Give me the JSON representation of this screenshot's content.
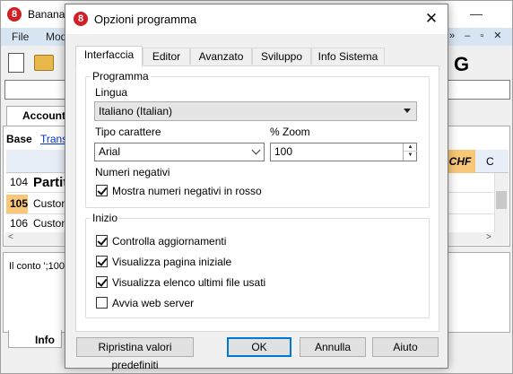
{
  "background_window": {
    "title": "Banana",
    "menu": [
      "File",
      "Mod"
    ],
    "toolbar_partial_label": "G",
    "accounts_tab": "Accounts",
    "base_label": "Base",
    "trans_label": "Transa",
    "chf_header": "CHF",
    "col_c_header": "C",
    "rows": [
      {
        "num": "104",
        "text": "Partit"
      },
      {
        "num": "105",
        "text": "Custon"
      },
      {
        "num": "106",
        "text": "Custon"
      }
    ],
    "info_text": "Il conto ';100",
    "info_tab": "Info"
  },
  "dialog": {
    "title": "Opzioni programma",
    "tabs": [
      "Interfaccia",
      "Editor",
      "Avanzato",
      "Sviluppo",
      "Info Sistema"
    ],
    "active_tab": "Interfaccia",
    "programma": {
      "group_label": "Programma",
      "lingua_label": "Lingua",
      "lingua_value": "Italiano (Italian)",
      "font_label": "Tipo carattere",
      "font_value": "Arial",
      "zoom_label": "% Zoom",
      "zoom_value": "100",
      "negativi_label": "Numeri negativi",
      "negativi_checkbox": {
        "label": "Mostra numeri negativi in rosso",
        "checked": true
      }
    },
    "inizio": {
      "group_label": "Inizio",
      "checkboxes": [
        {
          "label": "Controlla aggiornamenti",
          "checked": true
        },
        {
          "label": "Visualizza pagina iniziale",
          "checked": true
        },
        {
          "label": "Visualizza elenco ultimi file usati",
          "checked": true
        },
        {
          "label": "Avvia web server",
          "checked": false
        }
      ]
    },
    "buttons": {
      "reset": "Ripristina valori predefiniti",
      "ok": "OK",
      "cancel": "Annulla",
      "help": "Aiuto"
    }
  }
}
